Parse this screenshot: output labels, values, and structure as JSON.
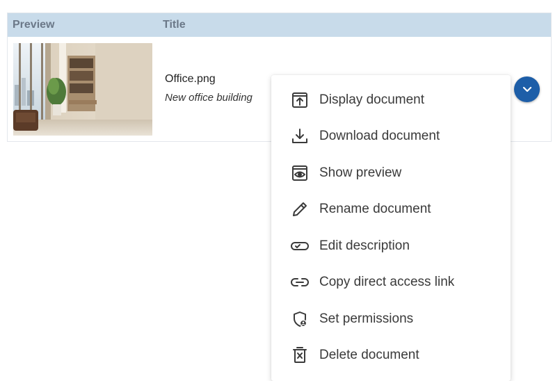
{
  "table": {
    "columns": {
      "preview": "Preview",
      "title": "Title"
    },
    "rows": [
      {
        "title": "Office.png",
        "description": "New office building"
      }
    ]
  },
  "menu": {
    "items": [
      {
        "label": "Display document",
        "icon": "display-document-icon"
      },
      {
        "label": "Download document",
        "icon": "download-icon"
      },
      {
        "label": "Show preview",
        "icon": "eye-icon"
      },
      {
        "label": "Rename document",
        "icon": "pencil-icon"
      },
      {
        "label": "Edit description",
        "icon": "edit-description-icon"
      },
      {
        "label": "Copy direct access link",
        "icon": "link-icon"
      },
      {
        "label": "Set permissions",
        "icon": "shield-user-icon"
      },
      {
        "label": "Delete document",
        "icon": "delete-document-icon"
      }
    ]
  },
  "colors": {
    "header_bg": "#c8dbea",
    "accent": "#1d5ea8"
  }
}
